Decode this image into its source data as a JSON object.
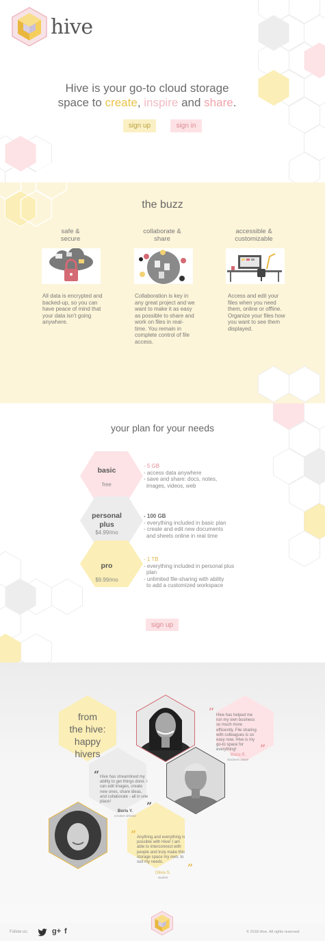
{
  "brand": {
    "name": "hive"
  },
  "hero": {
    "line1": "Hive is your go-to cloud storage",
    "line2_prefix": "space to ",
    "word_create": "create",
    "sep": ", ",
    "word_inspire": "inspire",
    "and": " and ",
    "word_share": "share",
    "period": ".",
    "signup_label": "sign up",
    "signin_label": "sign in"
  },
  "buzz": {
    "title": "the buzz",
    "features": [
      {
        "title": "safe &\nsecure",
        "text": "All data is encrypted and backed-up, so you can have peace of mind that your data isn't going anywhere."
      },
      {
        "title": "collaborate &\nshare",
        "text": "Collaboration is key in any great project and we want to make it as easy as possible to share and work on files in real-time.  You remain in complete control of file access."
      },
      {
        "title": "accessible &\ncustomizable",
        "text": "Access and edit your files when you need them, online or offline.  Organize your files how you want to see them displayed."
      }
    ]
  },
  "plans": {
    "title": "your plan for your needs",
    "items": [
      {
        "name": "basic",
        "price": "free",
        "highlight": "- 5 GB",
        "lines": [
          "- access data anywhere",
          "- save and share: docs, notes,",
          "  images, videos, web"
        ]
      },
      {
        "name": "personal\nplus",
        "price": "$4.99/mo",
        "highlight": "- 100 GB",
        "lines": [
          "- everything included in basic plan",
          "- create and edit new documents",
          "  and sheets online in real time"
        ]
      },
      {
        "name": "pro",
        "price": "$9.99/mo",
        "highlight": "- 1 TB",
        "lines": [
          "- everything included in personal plus",
          "  plan",
          "- unlimited file-sharing with ability",
          "  to add a customized workspace"
        ]
      }
    ],
    "signup_label": "sign up"
  },
  "testimonials": {
    "heading": "from\nthe hive:\nhappy\nhivers",
    "items": [
      {
        "quote": "Hive has helped me run my own business so much more efficiently.  File sharing with colleagues is so easy now.  Hive is my go-to space for everything!",
        "name": "Maria R.",
        "role": "business owner"
      },
      {
        "quote": "Hive has streamlined my ability to get things done.  I can edit images, create new ones, share ideas, and collaborate - all in one place!",
        "name": "Boris Y.",
        "role": "creative director"
      },
      {
        "quote": "Anything and everything is possible with Hive! I am able to interconnect with people and  truly make this storage space my own, to suit my needs.",
        "name": "Olivia S.",
        "role": "student"
      }
    ]
  },
  "footer": {
    "follow": "Follow us:",
    "twitter": "twitter-icon",
    "gplus": "g+",
    "facebook": "f",
    "copyright": "© 2018 Hive.  All rights reserved."
  },
  "colors": {
    "yellow": "#fbe9a8",
    "pink": "#fbd4d8",
    "grey": "#e4e4e4",
    "cream": "#fdf5d9"
  }
}
